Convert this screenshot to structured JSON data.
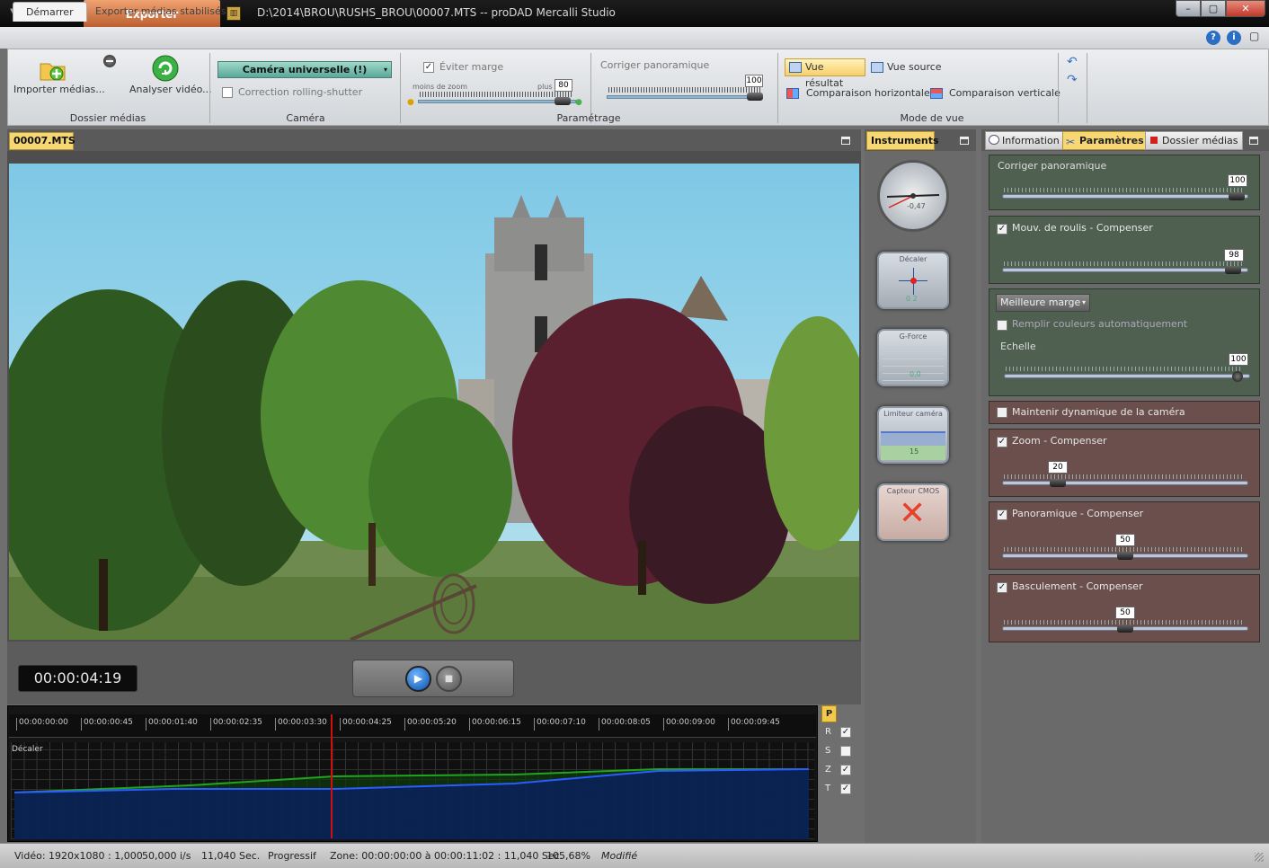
{
  "window": {
    "title": "D:\\2014\\BROU\\RUSHS_BROU\\00007.MTS -- proDAD Mercalli Studio",
    "export_tab": "Exporter",
    "sys_menu": "▼",
    "app_icon": "▥",
    "min": "–",
    "max": "▢",
    "close": "✕"
  },
  "ribbon": {
    "tabs": [
      "Démarrer",
      "Exporter médias stabilisés"
    ],
    "help": "?",
    "info": "i",
    "collapse": "▢",
    "groups": {
      "media": {
        "label": "Dossier médias",
        "import": "Importer médias...",
        "analyze": "Analyser vidéo..."
      },
      "camera": {
        "label": "Caméra",
        "select": "Caméra universelle (!)",
        "rolling_shutter": "Correction rolling-shutter"
      },
      "params": {
        "label": "Paramétrage",
        "eviter_marge": "Éviter marge",
        "zoom_less": "moins de zoom",
        "zoom_more": "plus",
        "zoom_value": "80",
        "corriger": "Corriger panoramique",
        "corriger_value": "100"
      },
      "view": {
        "label": "Mode de vue",
        "result": "Vue résultat",
        "source": "Vue source",
        "horiz": "Comparaison horizontale",
        "vert": "Comparaison verticale"
      }
    }
  },
  "video_pane": {
    "file_tab": "00007.MTS",
    "timecode": "00:00:04:19"
  },
  "timeline": {
    "ticks": [
      "00:00:00:00",
      "00:00:00:45",
      "00:00:01:40",
      "00:00:02:35",
      "00:00:03:30",
      "00:00:04:25",
      "00:00:05:20",
      "00:00:06:15",
      "00:00:07:10",
      "00:00:08:05",
      "00:00:09:00",
      "00:00:09:45"
    ],
    "graph_label": "Décaler",
    "p_button": "P",
    "channels": [
      {
        "key": "R",
        "checked": "✓"
      },
      {
        "key": "S",
        "checked": ""
      },
      {
        "key": "Z",
        "checked": "✓"
      },
      {
        "key": "T",
        "checked": "✓"
      }
    ]
  },
  "instruments": {
    "tab": "Instruments",
    "horizon_value": "-0,47",
    "shift": "Décaler",
    "shift_value": "0  2",
    "gforce": "G-Force",
    "gforce_value": "0,0",
    "limiter": "Limiteur caméra",
    "limiter_value": "15",
    "cmos": "Capteur CMOS"
  },
  "right_tabs": {
    "info": "Information",
    "params": "Paramètres",
    "media": "Dossier médias"
  },
  "params": {
    "corriger": {
      "label": "Corriger panoramique",
      "value": "100"
    },
    "roulis": {
      "label": "Mouv. de roulis - Compenser",
      "value": "98",
      "checked": "✓"
    },
    "marge": {
      "select": "Meilleure marge",
      "remplir": "Remplir couleurs automatiquement",
      "echelle": "Echelle",
      "value": "100"
    },
    "maintenir": {
      "label": "Maintenir dynamique de la caméra"
    },
    "zoom": {
      "label": "Zoom - Compenser",
      "value": "20",
      "checked": "✓"
    },
    "pano": {
      "label": "Panoramique - Compenser",
      "value": "50",
      "checked": "✓"
    },
    "bascul": {
      "label": "Basculement - Compenser",
      "value": "50",
      "checked": "✓"
    }
  },
  "status": {
    "video": "Vidéo: 1920x1080 : 1,000",
    "fps": "50,000 i/s",
    "duration": "11,040 Sec.",
    "scan": "Progressif",
    "zone": "Zone: 00:00:00:00 à 00:00:11:02 : 11,040 Sec.",
    "zoom": "105,68%",
    "modified": "Modifié"
  },
  "colors": {
    "accent": "#f7d774",
    "export": "#c96a38",
    "panel_green": "#4f6050",
    "panel_red": "#6b4f4c"
  }
}
